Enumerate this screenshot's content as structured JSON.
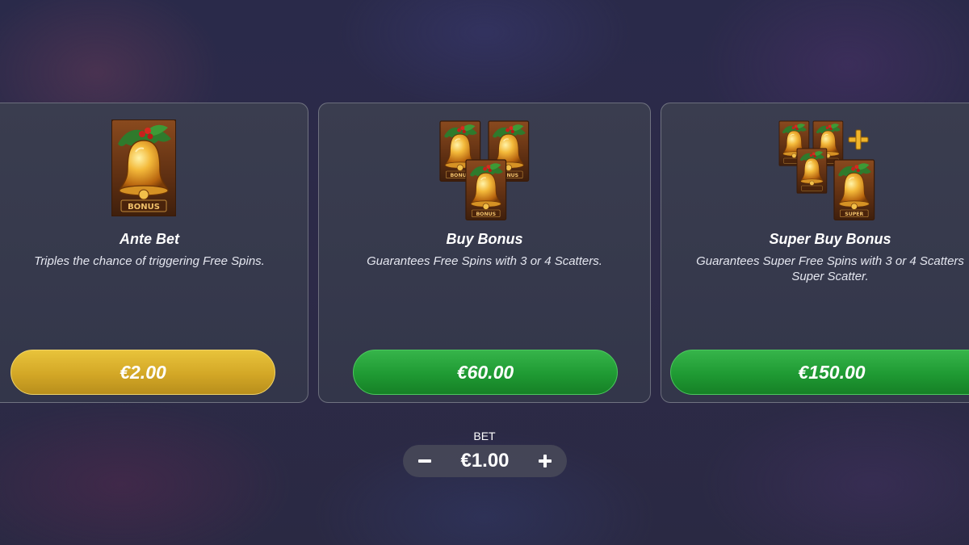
{
  "features": [
    {
      "title": "Ante Bet",
      "description": "Triples the chance of triggering Free Spins.",
      "price": "€2.00",
      "button_color": "#d3a726",
      "icon": "bonus-bell-card-icon",
      "icon_text": "BONUS"
    },
    {
      "title": "Buy Bonus",
      "description": "Guarantees Free Spins with 3 or 4 Scatters.",
      "price": "€60.00",
      "button_color": "#1f9a33",
      "icon": "three-bonus-bell-cards-icon",
      "icon_text": "BONUS"
    },
    {
      "title": "Super Buy Bonus",
      "description": "Guarantees Super Free Spins with 3 or 4 Scatters\nSuper Scatter.",
      "price": "€150.00",
      "button_color": "#1f9a33",
      "icon": "bonus-and-super-bell-cards-icon",
      "icon_text": "SUPER"
    }
  ],
  "bet": {
    "label": "BET",
    "value": "€1.00",
    "decrease_icon": "minus-icon",
    "increase_icon": "plus-icon"
  }
}
